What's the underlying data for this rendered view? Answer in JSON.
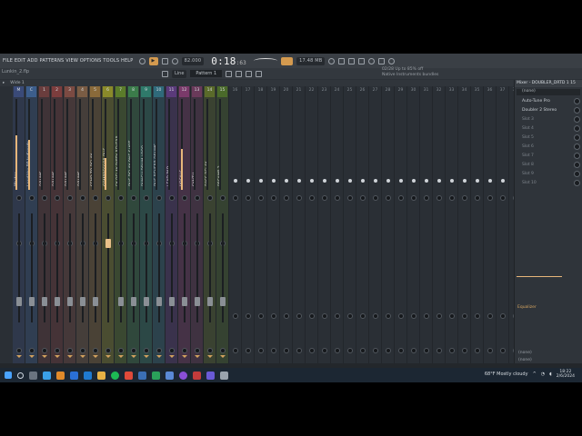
{
  "menubar": {
    "menu": "FILE EDIT ADD PATTERNS VIEW OPTIONS TOOLS HELP",
    "tempo": "82.000",
    "time_main": "0:18",
    "time_sub": ":63",
    "cpu": "17.48 MB",
    "cpu_sub": "3 s1"
  },
  "toolbar2": {
    "snap": "Line",
    "pattern": "Pattern 1",
    "hint": "Lunkin_2.flp"
  },
  "news": {
    "line1": "02/28  Up to 85% off",
    "line2": "Native Instruments bundles"
  },
  "mixhead": {
    "view": "Wide 1"
  },
  "strips": [
    {
      "num": "M",
      "name": "Master",
      "color": "#3a4a78",
      "meter": 0.6,
      "selected": false
    },
    {
      "num": "C",
      "name": "Lead Vox BP Indicorde",
      "color": "#3c5e8c",
      "meter": 0.55,
      "selected": false
    },
    {
      "num": "1",
      "name": "DRUMS",
      "color": "#6a3d3d",
      "meter": 0.0,
      "selected": false
    },
    {
      "num": "2",
      "name": "DRUMS",
      "color": "#7c3d3d",
      "meter": 0.0,
      "selected": false
    },
    {
      "num": "3",
      "name": "DRUMS",
      "color": "#7b4a42",
      "meter": 0.0,
      "selected": false
    },
    {
      "num": "4",
      "name": "DRUMS",
      "color": "#7a5c44",
      "meter": 0.0,
      "selected": false
    },
    {
      "num": "5",
      "name": "SEND TO DELAY",
      "color": "#8a6a3a",
      "meter": 0.0,
      "selected": false
    },
    {
      "num": "6",
      "name": "COMPRESSOR BUS",
      "color": "#8a8a2a",
      "meter": 0.35,
      "selected": true
    },
    {
      "num": "7",
      "name": "FX DELAY DIRTY REVERB",
      "color": "#5b7c2a",
      "meter": 0.0,
      "selected": false
    },
    {
      "num": "8",
      "name": "BUS DELAY ONE SHOT",
      "color": "#3b7c4a",
      "meter": 0.0,
      "selected": false
    },
    {
      "num": "9",
      "name": "PUNCH DRUM LOOP",
      "color": "#2f7a6a",
      "meter": 0.0,
      "selected": false
    },
    {
      "num": "10",
      "name": "BUS REVERB DRUMS",
      "color": "#2f6a7a",
      "meter": 0.0,
      "selected": false
    },
    {
      "num": "11",
      "name": "LEAD PAD",
      "color": "#5a3a7a",
      "meter": 0.0,
      "selected": false
    },
    {
      "num": "12",
      "name": "VOCALS",
      "color": "#7a3a6a",
      "meter": 0.45,
      "selected": false
    },
    {
      "num": "13",
      "name": "SYNTH",
      "color": "#6a3a5a",
      "meter": 0.0,
      "selected": false
    },
    {
      "num": "14",
      "name": "BASS RELAY",
      "color": "#5a6a2a",
      "meter": 0.0,
      "selected": false
    },
    {
      "num": "15",
      "name": "PREAMP 2",
      "color": "#4a6a2a",
      "meter": 0.0,
      "selected": false
    }
  ],
  "empty_inserts": [
    "16",
    "17",
    "18",
    "19",
    "20",
    "21",
    "22",
    "23",
    "24",
    "25",
    "26",
    "27",
    "28",
    "29",
    "30",
    "31",
    "32",
    "33",
    "34",
    "35",
    "36",
    "37",
    "38",
    "39",
    "40",
    "41",
    "42",
    "43",
    "44",
    "45",
    "46",
    "47",
    "48"
  ],
  "rack": {
    "title": "Mixer - DOUBLER_DRTD 1 15",
    "preset": "(none)",
    "slots": [
      {
        "label": "Auto-Tune Pro",
        "on": true
      },
      {
        "label": "Doubler 2 Stereo",
        "on": true
      },
      {
        "label": "Slot 3",
        "on": false
      },
      {
        "label": "Slot 4",
        "on": false
      },
      {
        "label": "Slot 5",
        "on": false
      },
      {
        "label": "Slot 6",
        "on": false
      },
      {
        "label": "Slot 7",
        "on": false
      },
      {
        "label": "Slot 8",
        "on": false
      },
      {
        "label": "Slot 9",
        "on": false
      },
      {
        "label": "Slot 10",
        "on": false
      }
    ],
    "eq_label": "Equalizer",
    "out1": "(none)",
    "out2": "(none)"
  },
  "taskbar": {
    "weather": "68°F  Mostly cloudy",
    "time": "18:22",
    "date": "2/6/2024"
  },
  "colors": {
    "accent": "#e7b67a",
    "bg": "#2b3036"
  }
}
